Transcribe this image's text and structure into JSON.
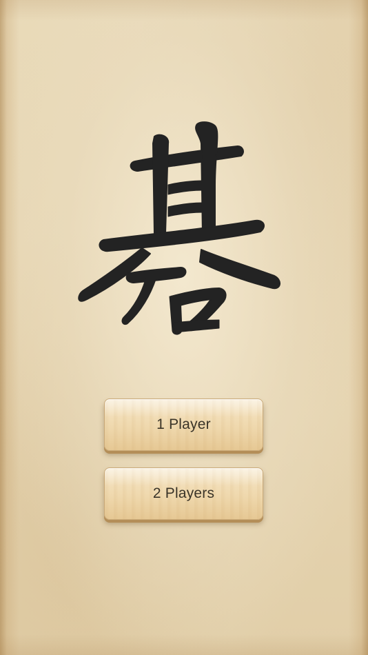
{
  "logo": {
    "glyph": "碁",
    "ink_color": "#232323"
  },
  "menu": {
    "one_player_label": "1 Player",
    "two_players_label": "2 Players"
  },
  "colors": {
    "paper": "#e6d6b4",
    "button_wood": "#efd8ad",
    "button_text": "#3a3428"
  }
}
